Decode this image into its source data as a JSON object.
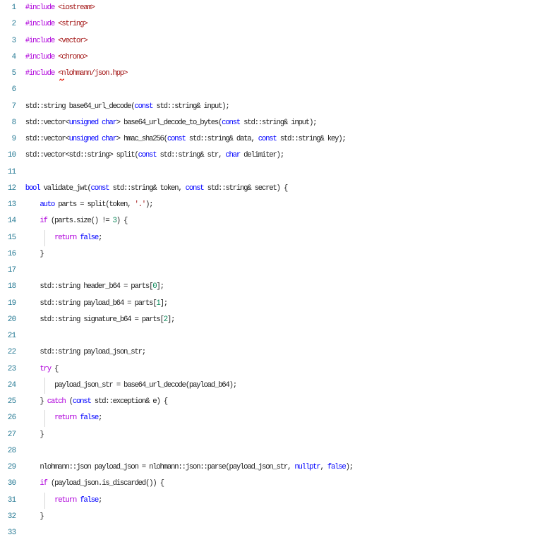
{
  "editor": {
    "colors": {
      "background": "#ffffff",
      "line_number": "#237893",
      "text": "#1f1f1f",
      "keyword": "#0000ff",
      "control": "#af00db",
      "string": "#a31515",
      "number": "#098658",
      "indent_guide": "#d6d6d6",
      "error_squiggle": "#e51400"
    },
    "lines": [
      {
        "n": "1",
        "indent": 0,
        "tokens": [
          [
            "ctl",
            "#include "
          ],
          [
            "str",
            "<iostream>"
          ]
        ]
      },
      {
        "n": "2",
        "indent": 0,
        "tokens": [
          [
            "ctl",
            "#include "
          ],
          [
            "str",
            "<string>"
          ]
        ]
      },
      {
        "n": "3",
        "indent": 0,
        "tokens": [
          [
            "ctl",
            "#include "
          ],
          [
            "str",
            "<vector>"
          ]
        ]
      },
      {
        "n": "4",
        "indent": 0,
        "tokens": [
          [
            "ctl",
            "#include "
          ],
          [
            "str",
            "<chrono>"
          ]
        ]
      },
      {
        "n": "5",
        "indent": 0,
        "tokens": [
          [
            "ctl",
            "#include "
          ],
          [
            "str",
            "<nlohmann/json.hpp>"
          ]
        ],
        "squiggle": true
      },
      {
        "n": "6",
        "indent": 0,
        "tokens": []
      },
      {
        "n": "7",
        "indent": 0,
        "tokens": [
          [
            "txt",
            "std::string base64_url_decode("
          ],
          [
            "kw",
            "const"
          ],
          [
            "txt",
            " std::string& input);"
          ]
        ]
      },
      {
        "n": "8",
        "indent": 0,
        "tokens": [
          [
            "txt",
            "std::vector<"
          ],
          [
            "kw",
            "unsigned char"
          ],
          [
            "txt",
            "> base64_url_decode_to_bytes("
          ],
          [
            "kw",
            "const"
          ],
          [
            "txt",
            " std::string& input);"
          ]
        ]
      },
      {
        "n": "9",
        "indent": 0,
        "tokens": [
          [
            "txt",
            "std::vector<"
          ],
          [
            "kw",
            "unsigned char"
          ],
          [
            "txt",
            "> hmac_sha256("
          ],
          [
            "kw",
            "const"
          ],
          [
            "txt",
            " std::string& data, "
          ],
          [
            "kw",
            "const"
          ],
          [
            "txt",
            " std::string& key);"
          ]
        ]
      },
      {
        "n": "10",
        "indent": 0,
        "tokens": [
          [
            "txt",
            "std::vector<std::string> split("
          ],
          [
            "kw",
            "const"
          ],
          [
            "txt",
            " std::string& str, "
          ],
          [
            "kw",
            "char"
          ],
          [
            "txt",
            " delimiter);"
          ]
        ]
      },
      {
        "n": "11",
        "indent": 0,
        "tokens": []
      },
      {
        "n": "12",
        "indent": 0,
        "tokens": [
          [
            "kw",
            "bool"
          ],
          [
            "txt",
            " validate_jwt("
          ],
          [
            "kw",
            "const"
          ],
          [
            "txt",
            " std::string& token, "
          ],
          [
            "kw",
            "const"
          ],
          [
            "txt",
            " std::string& secret) {"
          ]
        ]
      },
      {
        "n": "13",
        "indent": 1,
        "tokens": [
          [
            "kw",
            "auto"
          ],
          [
            "txt",
            " parts = split(token, "
          ],
          [
            "str",
            "'.'"
          ],
          [
            "txt",
            ");"
          ]
        ]
      },
      {
        "n": "14",
        "indent": 1,
        "tokens": [
          [
            "ctl",
            "if"
          ],
          [
            "txt",
            " (parts.size() != "
          ],
          [
            "num",
            "3"
          ],
          [
            "txt",
            ") {"
          ]
        ]
      },
      {
        "n": "15",
        "indent": 2,
        "tokens": [
          [
            "ctl",
            "return"
          ],
          [
            "txt",
            " "
          ],
          [
            "kw",
            "false"
          ],
          [
            "txt",
            ";"
          ]
        ]
      },
      {
        "n": "16",
        "indent": 1,
        "tokens": [
          [
            "txt",
            "}"
          ]
        ]
      },
      {
        "n": "17",
        "indent": 0,
        "tokens": []
      },
      {
        "n": "18",
        "indent": 1,
        "tokens": [
          [
            "txt",
            "std::string header_b64 = parts["
          ],
          [
            "num",
            "0"
          ],
          [
            "txt",
            "];"
          ]
        ]
      },
      {
        "n": "19",
        "indent": 1,
        "tokens": [
          [
            "txt",
            "std::string payload_b64 = parts["
          ],
          [
            "num",
            "1"
          ],
          [
            "txt",
            "];"
          ]
        ]
      },
      {
        "n": "20",
        "indent": 1,
        "tokens": [
          [
            "txt",
            "std::string signature_b64 = parts["
          ],
          [
            "num",
            "2"
          ],
          [
            "txt",
            "];"
          ]
        ]
      },
      {
        "n": "21",
        "indent": 0,
        "tokens": []
      },
      {
        "n": "22",
        "indent": 1,
        "tokens": [
          [
            "txt",
            "std::string payload_json_str;"
          ]
        ]
      },
      {
        "n": "23",
        "indent": 1,
        "tokens": [
          [
            "ctl",
            "try"
          ],
          [
            "txt",
            " {"
          ]
        ]
      },
      {
        "n": "24",
        "indent": 2,
        "tokens": [
          [
            "txt",
            "payload_json_str = base64_url_decode(payload_b64);"
          ]
        ]
      },
      {
        "n": "25",
        "indent": 1,
        "tokens": [
          [
            "txt",
            "} "
          ],
          [
            "ctl",
            "catch"
          ],
          [
            "txt",
            " ("
          ],
          [
            "kw",
            "const"
          ],
          [
            "txt",
            " std::exception& e) {"
          ]
        ]
      },
      {
        "n": "26",
        "indent": 2,
        "tokens": [
          [
            "ctl",
            "return"
          ],
          [
            "txt",
            " "
          ],
          [
            "kw",
            "false"
          ],
          [
            "txt",
            ";"
          ]
        ]
      },
      {
        "n": "27",
        "indent": 1,
        "tokens": [
          [
            "txt",
            "}"
          ]
        ]
      },
      {
        "n": "28",
        "indent": 0,
        "tokens": []
      },
      {
        "n": "29",
        "indent": 1,
        "tokens": [
          [
            "txt",
            "nlohmann::json payload_json = nlohmann::json::parse(payload_json_str, "
          ],
          [
            "kw",
            "nullptr"
          ],
          [
            "txt",
            ", "
          ],
          [
            "kw",
            "false"
          ],
          [
            "txt",
            ");"
          ]
        ]
      },
      {
        "n": "30",
        "indent": 1,
        "tokens": [
          [
            "ctl",
            "if"
          ],
          [
            "txt",
            " (payload_json.is_discarded()) {"
          ]
        ]
      },
      {
        "n": "31",
        "indent": 2,
        "tokens": [
          [
            "ctl",
            "return"
          ],
          [
            "txt",
            " "
          ],
          [
            "kw",
            "false"
          ],
          [
            "txt",
            ";"
          ]
        ]
      },
      {
        "n": "32",
        "indent": 1,
        "tokens": [
          [
            "txt",
            "}"
          ]
        ]
      },
      {
        "n": "33",
        "indent": 0,
        "tokens": []
      }
    ]
  }
}
